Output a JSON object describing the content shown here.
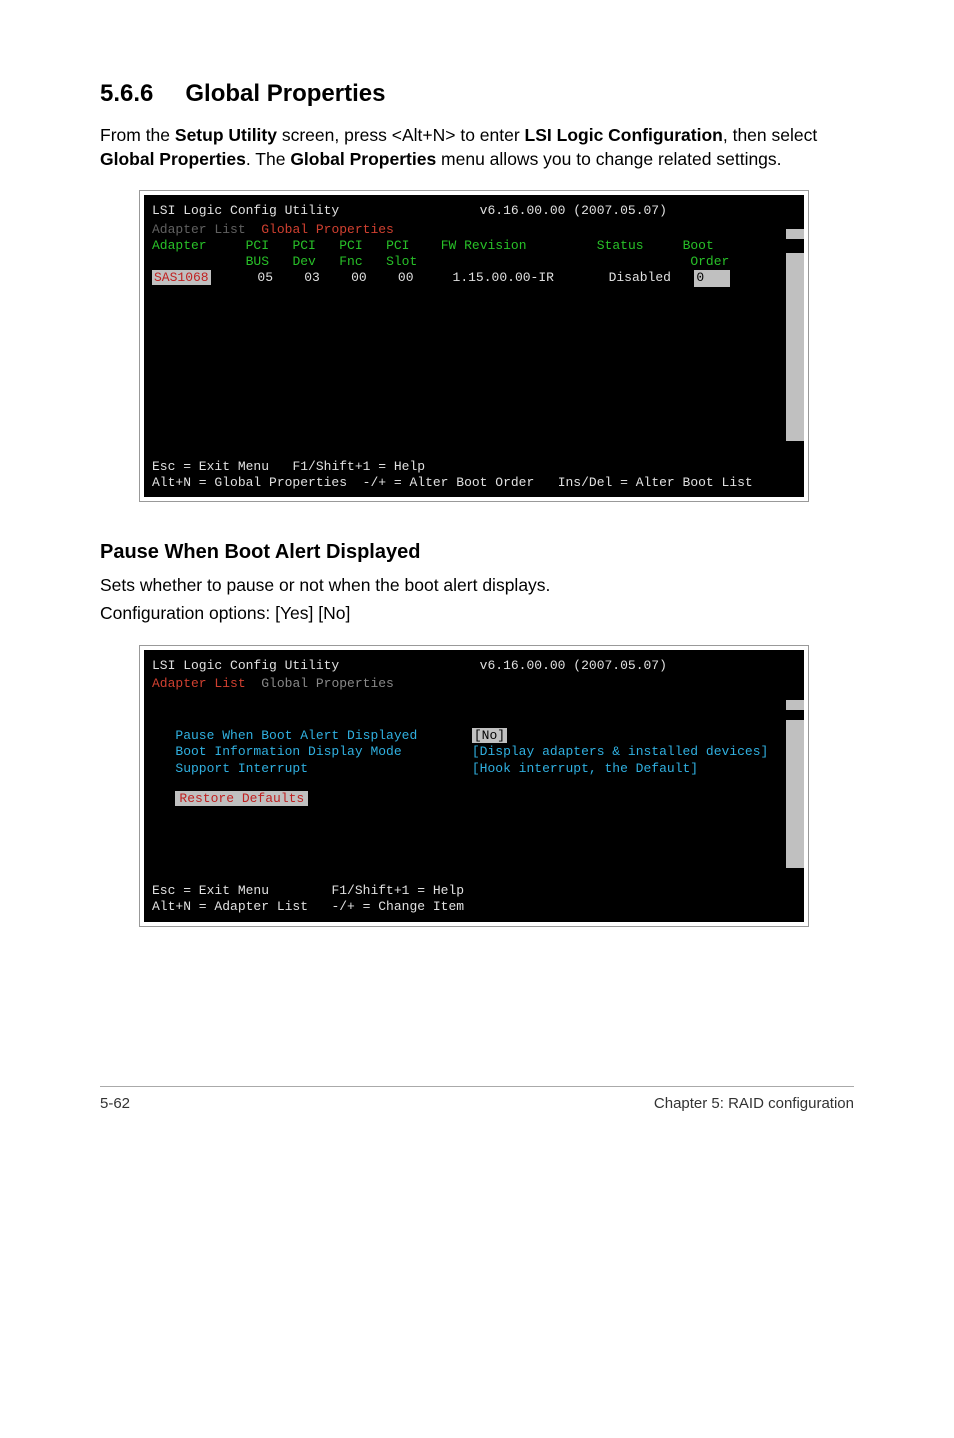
{
  "section": {
    "number": "5.6.6",
    "title": "Global Properties"
  },
  "intro": {
    "pre": "From the ",
    "b1": "Setup Utility",
    "mid1": " screen, press <Alt+N> to enter ",
    "b2": "LSI Logic Configuration",
    "mid2": ", then select ",
    "b3": "Global Properties",
    "mid3": ". The ",
    "b4": "Global Properties",
    "post": " menu allows you to change related settings."
  },
  "term1": {
    "title_left": "LSI Logic Config Utility",
    "title_right": "v6.16.00.00 (2007.05.07)",
    "crumb1": "Adapter List",
    "crumb2": "Global Properties",
    "hdr": {
      "c1": "Adapter",
      "c2a": "PCI",
      "c2b": "BUS",
      "c3a": "PCI",
      "c3b": "Dev",
      "c4a": "PCI",
      "c4b": "Fnc",
      "c5a": "PCI",
      "c5b": "Slot",
      "c6": "FW Revision",
      "c7": "Status",
      "c8a": "Boot",
      "c8b": "Order"
    },
    "row": {
      "adapter": "SAS1068",
      "bus": "05",
      "dev": "03",
      "fnc": "00",
      "slot": "00",
      "fw": "1.15.00.00-IR",
      "status": "Disabled",
      "boot": "0"
    },
    "foot1a": "Esc = Exit Menu",
    "foot1b": "F1/Shift+1 = Help",
    "foot2a": "Alt+N = Global Properties",
    "foot2b": "-/+ = Alter Boot Order",
    "foot2c": "Ins/Del = Alter Boot List"
  },
  "subsection": {
    "title": "Pause When Boot Alert Displayed",
    "line1": "Sets whether to pause or not when the boot alert displays.",
    "line2": "Configuration options: [Yes] [No]"
  },
  "term2": {
    "title_left": "LSI Logic Config Utility",
    "title_right": "v6.16.00.00 (2007.05.07)",
    "crumb1": "Adapter List",
    "crumb2": "Global Properties",
    "prop1_label": "Pause When Boot Alert Displayed",
    "prop1_value": "[No]",
    "prop2_label": "Boot Information Display Mode",
    "prop2_value": "[Display adapters & installed devices]",
    "prop3_label": "Support Interrupt",
    "prop3_value": "[Hook interrupt, the Default]",
    "restore": "Restore Defaults",
    "foot1a": "Esc = Exit Menu",
    "foot1b": "F1/Shift+1 = Help",
    "foot2a": "Alt+N = Adapter List",
    "foot2b": "-/+ = Change Item"
  },
  "footer": {
    "left": "5-62",
    "right": "Chapter 5: RAID configuration"
  }
}
